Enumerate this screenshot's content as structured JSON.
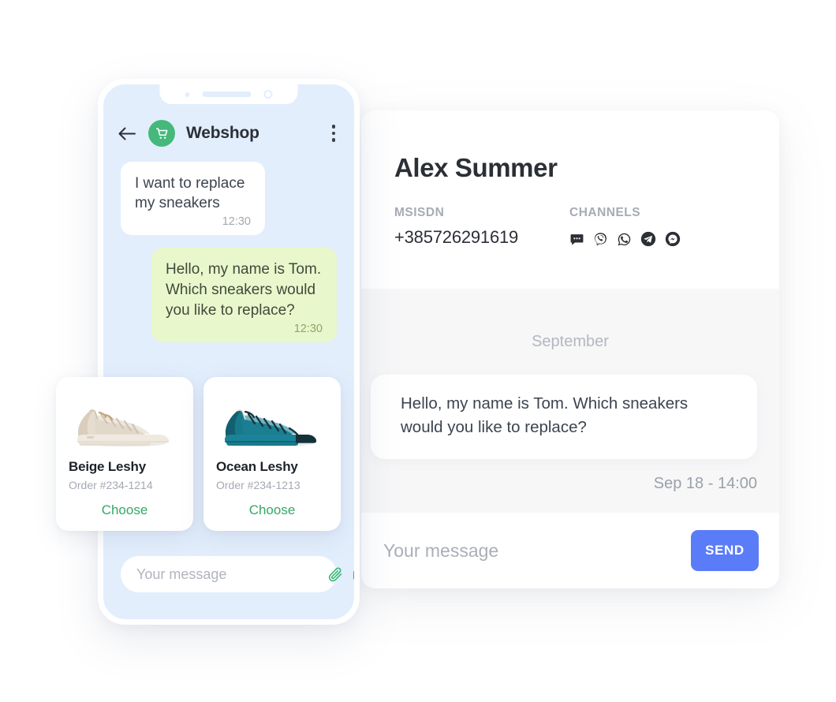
{
  "desktop_panel": {
    "contact_name": "Alex Summer",
    "msisdn_label": "MSISDN",
    "msisdn_value": "+385726291619",
    "channels_label": "CHANNELS",
    "channels": [
      {
        "name": "sms-icon",
        "title": "SMS"
      },
      {
        "name": "viber-icon",
        "title": "Viber"
      },
      {
        "name": "whatsapp-icon",
        "title": "WhatsApp"
      },
      {
        "name": "telegram-icon",
        "title": "Telegram"
      },
      {
        "name": "messenger-icon",
        "title": "Messenger"
      }
    ],
    "date_divider": "September",
    "message": "Hello, my name is Tom. Which sneakers would you like to replace?",
    "message_timestamp": "Sep 18 - 14:00",
    "input_placeholder": "Your message",
    "input_value": "",
    "send_label": "SEND",
    "accent_color": "#5b7cf8"
  },
  "phone": {
    "header": {
      "back_icon": "back-arrow-icon",
      "avatar_icon": "shopping-cart-icon",
      "title": "Webshop",
      "menu_icon": "kebab-menu-icon",
      "avatar_color": "#45b97c"
    },
    "messages": [
      {
        "direction": "incoming",
        "text": "I want to replace my sneakers",
        "time": "12:30"
      },
      {
        "direction": "outgoing",
        "text": "Hello, my name is Tom. Which sneakers would you like to replace?",
        "time": "12:30"
      }
    ],
    "product_cards": [
      {
        "name": "Beige Leshy",
        "order": "Order #234-1214",
        "choose_label": "Choose",
        "shoe_color": "#e6ddd0",
        "shoe_shade": "#d4c7b5",
        "shoe_sole": "#efe9e0",
        "lace_color": "#cfc3b2"
      },
      {
        "name": "Ocean Leshy",
        "order": "Order #234-1213",
        "choose_label": "Choose",
        "shoe_color": "#19798c",
        "shoe_shade": "#12606f",
        "shoe_sole": "#1b8397",
        "lace_color": "#17313a"
      }
    ],
    "input_placeholder": "Your message",
    "input_value": "",
    "attach_icon": "paperclip-icon",
    "camera_icon": "camera-icon",
    "icon_color": "#3cb878",
    "screen_background": "#e2eefc",
    "outgoing_bubble_color": "#e9f7cc"
  }
}
